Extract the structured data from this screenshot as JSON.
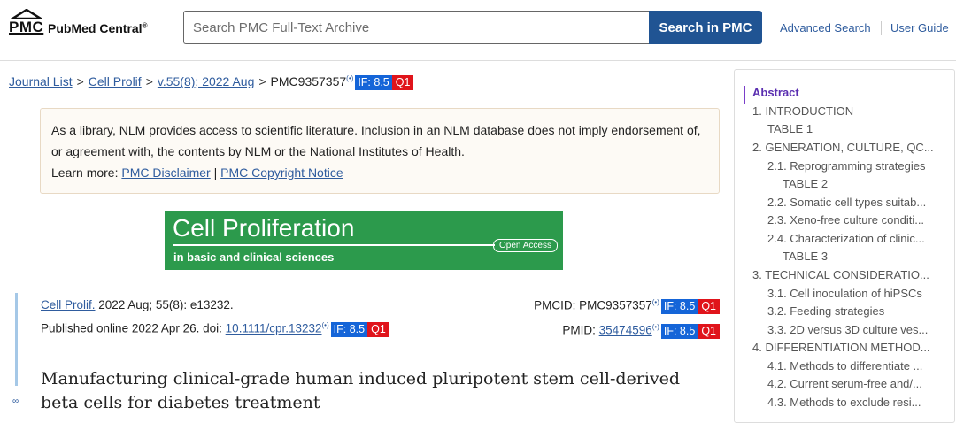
{
  "header": {
    "logo_mark": "PMC",
    "logo_text": "PubMed Central",
    "logo_reg": "®",
    "search_placeholder": "Search PMC Full-Text Archive",
    "search_button": "Search in PMC",
    "advanced_search": "Advanced Search",
    "user_guide": "User Guide"
  },
  "breadcrumb": {
    "journal_list": "Journal List",
    "journal": "Cell Prolif",
    "volume": "v.55(8); 2022 Aug",
    "sep": ">",
    "pmc_id": "PMC9357357",
    "if_label": "IF: 8.5",
    "quartile": "Q1"
  },
  "notice": {
    "text": "As a library, NLM provides access to scientific literature. Inclusion in an NLM database does not imply endorsement of, or agreement with, the contents by NLM or the National Institutes of Health.",
    "learn_more": "Learn more:",
    "disclaimer_link": "PMC Disclaimer",
    "divider": "|",
    "copyright_link": "PMC Copyright Notice"
  },
  "banner": {
    "title": "Cell Proliferation",
    "subtitle": "in basic and clinical sciences",
    "open_access": "Open Access"
  },
  "citation": {
    "journal_link": "Cell Prolif.",
    "details": " 2022 Aug; 55(8): e13232.",
    "published": "Published online 2022 Apr 26. doi: ",
    "doi": "10.1111/cpr.13232",
    "pmcid_label": "PMCID: PMC9357357",
    "pmid_label": "PMID: ",
    "pmid": "35474596",
    "if_label": "IF: 8.5",
    "quartile": "Q1"
  },
  "article": {
    "title": "Manufacturing clinical-grade human induced pluripotent stem cell-derived beta cells for diabetes treatment"
  },
  "toc": {
    "abstract": "Abstract",
    "items": [
      "1.  INTRODUCTION",
      "TABLE 1",
      "2.  GENERATION, CULTURE, QC...",
      "2.1. Reprogramming strategies",
      "TABLE 2",
      "2.2. Somatic cell types suitab...",
      "2.3. Xeno-free culture conditi...",
      "2.4. Characterization of clinic...",
      "TABLE 3",
      "3.  TECHNICAL CONSIDERATIO...",
      "3.1. Cell inoculation of hiPSCs",
      "3.2. Feeding strategies",
      "3.3. 2D versus 3D culture ves...",
      "4.  DIFFERENTIATION METHOD...",
      "4.1. Methods to differentiate ...",
      "4.2. Current serum-free and/...",
      "4.3. Methods to exclude resi..."
    ]
  },
  "icons": {
    "broadcast": "(•)"
  }
}
